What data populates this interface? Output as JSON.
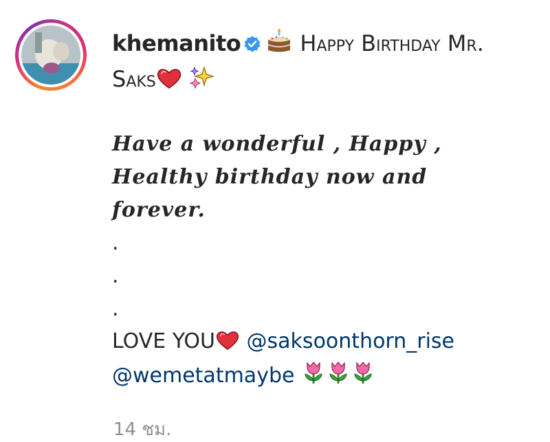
{
  "post": {
    "username": "khemanito",
    "title_text": "Happy Birthday Mr. Saks",
    "title_part1": "Happy Birthday Mr.",
    "title_part2": "Saks",
    "message_line1": "Have a wonderful , Happy ,",
    "message_line2": "Healthy birthday now and",
    "message_line3": "forever.",
    "dots": [
      ".",
      ".",
      "."
    ],
    "love_text": "LOVE YOU",
    "mention1": "@saksoonthorn_rise",
    "mention2": "@wemetatmaybe",
    "timestamp": "14 ชม."
  },
  "icons": {
    "verified": "verified-badge-icon",
    "cake": "birthday-cake-emoji",
    "heart": "red-heart-emoji",
    "sparkles": "sparkles-emoji",
    "tulip": "tulip-emoji"
  },
  "colors": {
    "verified": "#3897f0",
    "mention": "#00376b",
    "timestamp": "#8e8e8e",
    "text": "#262626"
  }
}
